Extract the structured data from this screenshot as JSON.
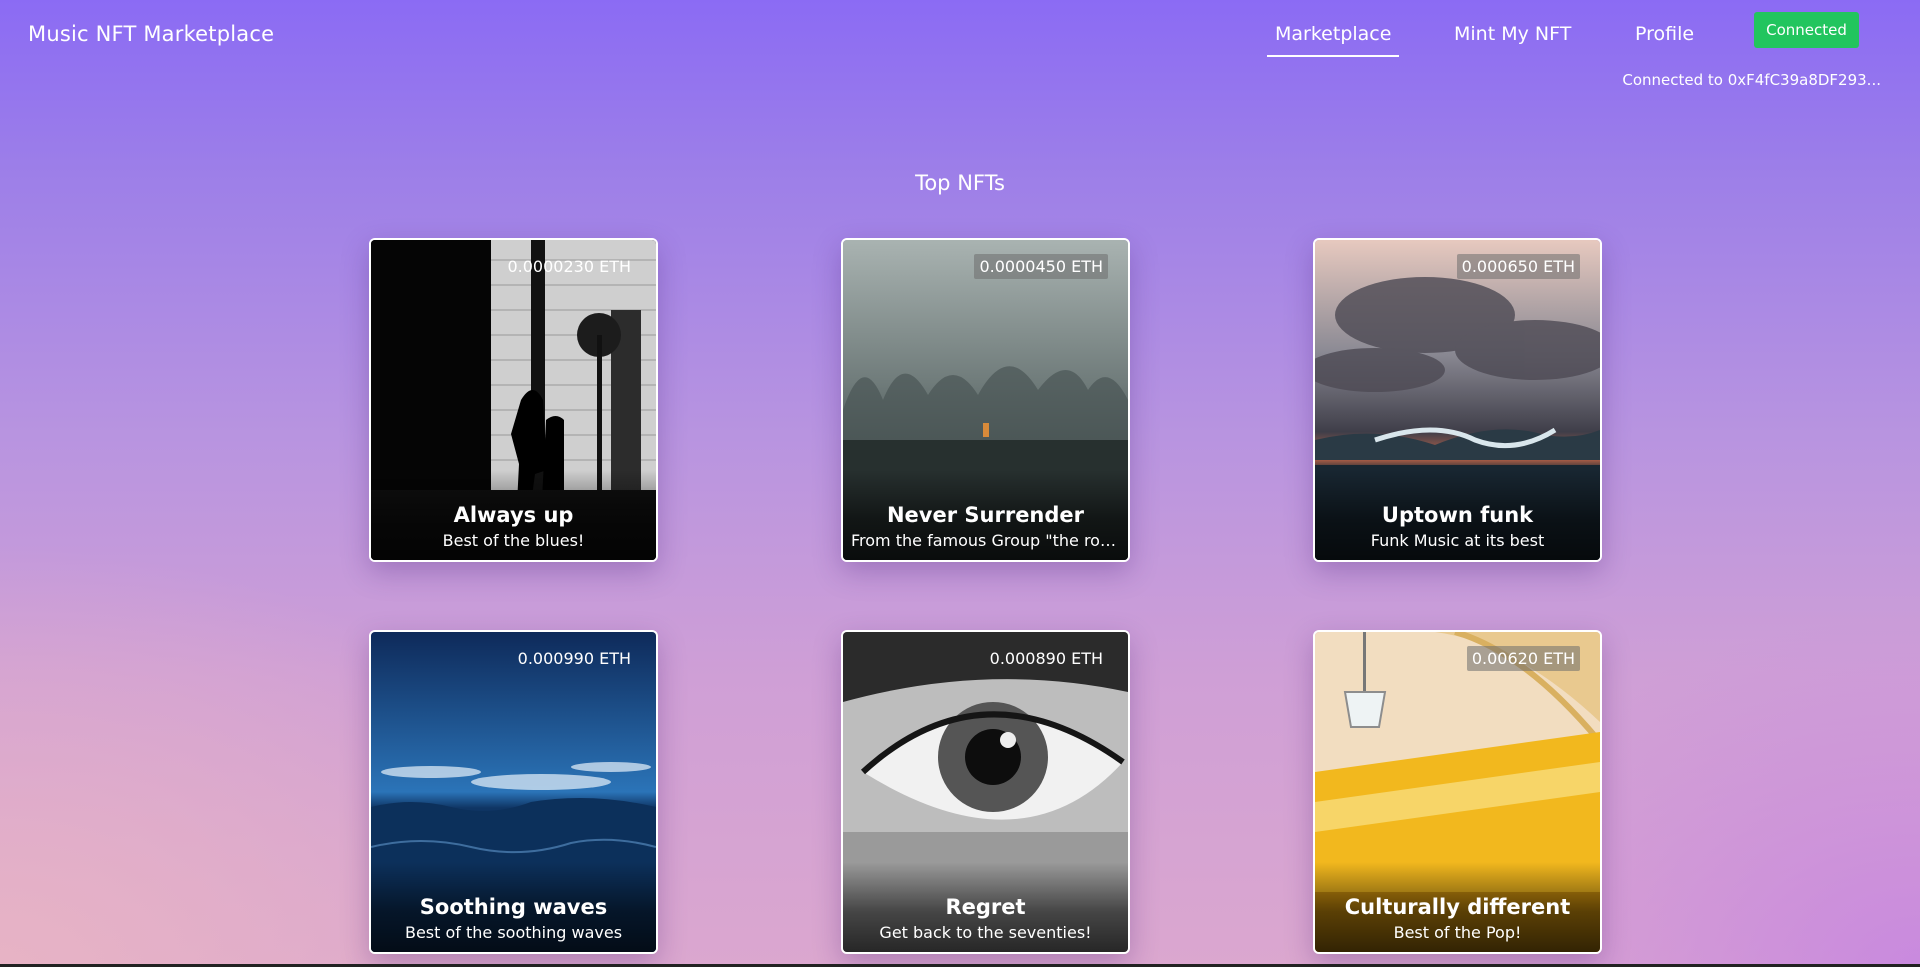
{
  "header": {
    "brand": "Music NFT Marketplace",
    "nav": [
      {
        "label": "Marketplace",
        "active": true
      },
      {
        "label": "Mint My NFT",
        "active": false
      },
      {
        "label": "Profile",
        "active": false
      }
    ],
    "connect_button": "Connected",
    "wallet_status": "Connected to 0xF4fC39a8DF293..."
  },
  "section_title": "Top NFTs",
  "nfts": [
    {
      "title": "Always up",
      "description": "Best of the blues!",
      "price": "0.0000230 ETH",
      "image": "street-silhouette"
    },
    {
      "title": "Never Surrender",
      "description": "From the famous Group \"the roo...",
      "price": "0.0000450 ETH",
      "image": "foggy-forest"
    },
    {
      "title": "Uptown funk",
      "description": "Funk Music at its best",
      "price": "0.000650 ETH",
      "image": "stormy-sea"
    },
    {
      "title": "Soothing waves",
      "description": "Best of the soothing waves",
      "price": "0.000990 ETH",
      "image": "blue-ocean"
    },
    {
      "title": "Regret",
      "description": "Get back to the seventies!",
      "price": "0.000890 ETH",
      "image": "eye-closeup"
    },
    {
      "title": "Culturally different",
      "description": "Best of the Pop!",
      "price": "0.00620 ETH",
      "image": "yellow-train"
    }
  ],
  "colors": {
    "connect_button": "#22c55e",
    "bg_top": "#8b6bf4",
    "bg_bottom": "#dba7cf"
  }
}
